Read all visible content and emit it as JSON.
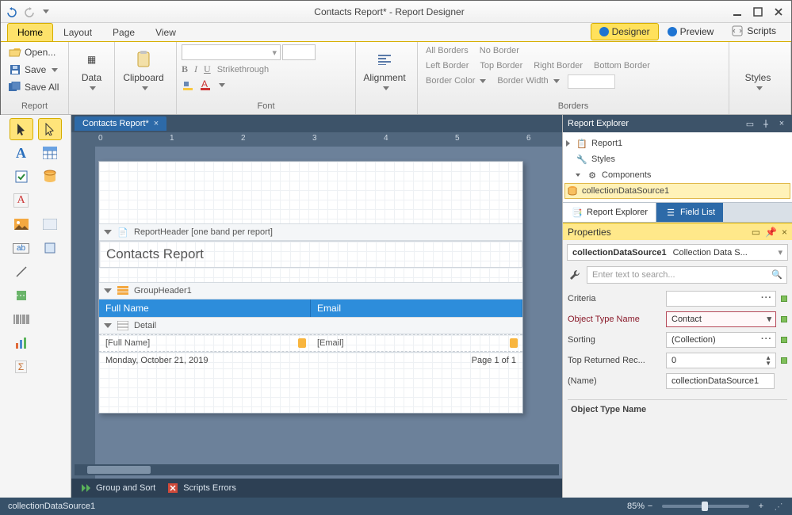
{
  "title": "Contacts Report* - Report Designer",
  "ribbon_tabs": {
    "home": "Home",
    "layout": "Layout",
    "page": "Page",
    "view": "View"
  },
  "modes": {
    "designer": "Designer",
    "preview": "Preview",
    "scripts": "Scripts"
  },
  "ribbon": {
    "report": {
      "label": "Report",
      "open": "Open...",
      "save": "Save",
      "save_all": "Save All"
    },
    "data": "Data",
    "clipboard": "Clipboard",
    "font": {
      "label": "Font",
      "strike": "Strikethrough"
    },
    "alignment": "Alignment",
    "borders": {
      "label": "Borders",
      "all": "All Borders",
      "no": "No Border",
      "left": "Left Border",
      "top": "Top Border",
      "right": "Right Border",
      "bottom": "Bottom Border",
      "color": "Border Color",
      "width": "Border Width"
    },
    "styles": "Styles"
  },
  "doc_tab": "Contacts Report*",
  "bands": {
    "report_header": "ReportHeader [one band per report]",
    "report_title": "Contacts Report",
    "group_header": "GroupHeader1",
    "col1": "Full Name",
    "col2": "Email",
    "detail": "Detail",
    "field1": "[Full Name]",
    "field2": "[Email]",
    "date": "Monday, October 21, 2019",
    "page": "Page 1 of 1"
  },
  "bottom_tabs": {
    "group": "Group and Sort",
    "errors": "Scripts Errors"
  },
  "explorer": {
    "title": "Report Explorer",
    "items": {
      "report1": "Report1",
      "styles": "Styles",
      "components": "Components",
      "cds": "collectionDataSource1"
    },
    "tabs": {
      "explorer": "Report Explorer",
      "fields": "Field List"
    }
  },
  "props": {
    "title": "Properties",
    "obj_name": "collectionDataSource1",
    "obj_type": "Collection Data S...",
    "search_placeholder": "Enter text to search...",
    "rows": {
      "criteria": {
        "label": "Criteria",
        "value": ""
      },
      "otn": {
        "label": "Object Type Name",
        "value": "Contact"
      },
      "sort": {
        "label": "Sorting",
        "value": "(Collection)"
      },
      "top": {
        "label": "Top Returned Rec...",
        "value": "0"
      },
      "name": {
        "label": "(Name)",
        "value": "collectionDataSource1"
      }
    },
    "desc": "Object Type Name"
  },
  "status": {
    "left": "collectionDataSource1",
    "zoom": "85%"
  }
}
